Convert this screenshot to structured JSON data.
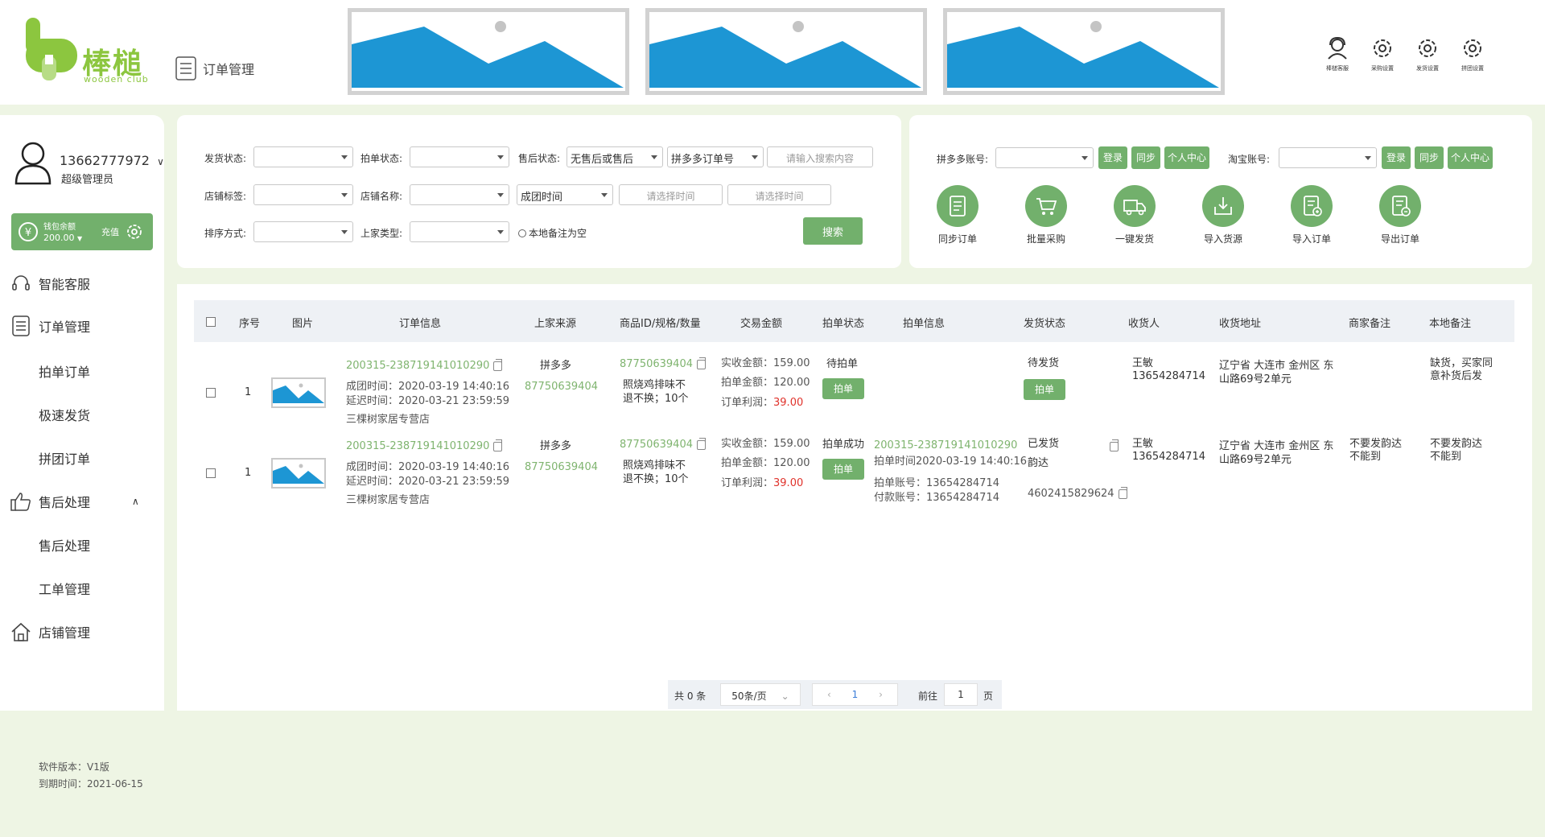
{
  "header": {
    "logo_text": "棒槌",
    "logo_sub": "wooden club",
    "page_title": "订单管理",
    "icons": [
      {
        "name": "customer-service-icon",
        "label": "棒槌客服"
      },
      {
        "name": "gear-icon",
        "label": "采购设置"
      },
      {
        "name": "gear-icon",
        "label": "发货设置"
      },
      {
        "name": "gear-icon",
        "label": "拼团设置"
      }
    ]
  },
  "user": {
    "phone": "13662777972",
    "role": "超级管理员",
    "wallet_label": "钱包余额",
    "wallet_amount": "200.00",
    "recharge": "充值"
  },
  "nav": {
    "smart_service": "智能客服",
    "order_mgmt": "订单管理",
    "sub_orders": [
      "拍单订单",
      "极速发货",
      "拼团订单"
    ],
    "after_sales": "售后处理",
    "sub_after_sales": [
      "售后处理",
      "工单管理"
    ],
    "store_mgmt": "店铺管理"
  },
  "filters": {
    "ship_status": "发货状态:",
    "bid_status": "拍单状态:",
    "after_status": "售后状态:",
    "after_value": "无售后或售后",
    "order_type": "拼多多订单号",
    "search_placeholder": "请输入搜索内容",
    "store_tag": "店铺标签:",
    "store_name": "店铺名称:",
    "time_type": "成团时间",
    "time_placeholder": "请选择时间",
    "sort": "排序方式:",
    "supplier_type": "上家类型:",
    "local_note_empty": "本地备注为空",
    "search_button": "搜索"
  },
  "accounts": {
    "pdd_label": "拼多多账号:",
    "taobao_label": "淘宝账号:",
    "login": "登录",
    "sync": "同步",
    "personal": "个人中心"
  },
  "tools": [
    "同步订单",
    "批量采购",
    "一键发货",
    "导入货源",
    "导入订单",
    "导出订单"
  ],
  "table": {
    "headers": [
      "序号",
      "图片",
      "订单信息",
      "上家来源",
      "商品ID/规格/数量",
      "交易金额",
      "拍单状态",
      "拍单信息",
      "发货状态",
      "收货人",
      "收货地址",
      "商家备注",
      "本地备注"
    ],
    "rows": [
      {
        "index": "1",
        "order_no": "200315-238719141010290",
        "group_time": "成团时间：2020-03-19 14:40:16",
        "delay_time": "延迟时间：2020-03-21 23:59:59",
        "store": "三棵树家居专营店",
        "source": "拼多多",
        "source_id": "87750639404",
        "product_id": "87750639404",
        "spec_line1": "照烧鸡排味不",
        "spec_line2": "退不换；10个",
        "actual": "实收金额：159.00",
        "bid_amount": "拍单金额：120.00",
        "profit_label": "订单利润：",
        "profit": "39.00",
        "bid_status": "待拍单",
        "bid_button": "拍单",
        "bid_info_no": "",
        "bid_info_time": "",
        "bid_info_acct": "",
        "bid_info_pay": "",
        "ship_status": "待发货",
        "ship_button": "拍单",
        "ship_company": "",
        "tracking": "",
        "receiver": "王敏",
        "receiver_phone": "13654284714",
        "address1": "辽宁省 大连市 金州区 东",
        "address2": "山路69号2单元",
        "merchant_note1": "",
        "merchant_note2": "",
        "local_note1": "缺货，买家同",
        "local_note2": "意补货后发"
      },
      {
        "index": "1",
        "order_no": "200315-238719141010290",
        "group_time": "成团时间：2020-03-19 14:40:16",
        "delay_time": "延迟时间：2020-03-21 23:59:59",
        "store": "三棵树家居专营店",
        "source": "拼多多",
        "source_id": "87750639404",
        "product_id": "87750639404",
        "spec_line1": "照烧鸡排味不",
        "spec_line2": "退不换；10个",
        "actual": "实收金额：159.00",
        "bid_amount": "拍单金额：120.00",
        "profit_label": "订单利润：",
        "profit": "39.00",
        "bid_status": "拍单成功",
        "bid_button": "拍单",
        "bid_info_no": "200315-238719141010290",
        "bid_info_time": "拍单时间2020-03-19 14:40:16",
        "bid_info_acct": "拍单账号：13654284714",
        "bid_info_pay": "付款账号：13654284714",
        "ship_status": "已发货",
        "ship_button": "",
        "ship_company": "韵达",
        "tracking": "4602415829624",
        "receiver": "王敏",
        "receiver_phone": "13654284714",
        "address1": "辽宁省 大连市 金州区 东",
        "address2": "山路69号2单元",
        "merchant_note1": "不要发韵达",
        "merchant_note2": "不能到",
        "local_note1": "不要发韵达",
        "local_note2": "不能到"
      }
    ]
  },
  "pagination": {
    "total": "共 0 条",
    "page_size": "50条/页",
    "prev": "‹",
    "current": "1",
    "next": "›",
    "goto_label": "前往",
    "goto_value": "1",
    "page_unit": "页"
  },
  "footer": {
    "version": "软件版本：V1版",
    "expire": "到期时间：2021-06-15"
  },
  "colors": {
    "accent": "#72b06c",
    "link_green": "#7fb46f",
    "profit_red": "#e0322b",
    "banner_blue": "#1d96d4"
  }
}
